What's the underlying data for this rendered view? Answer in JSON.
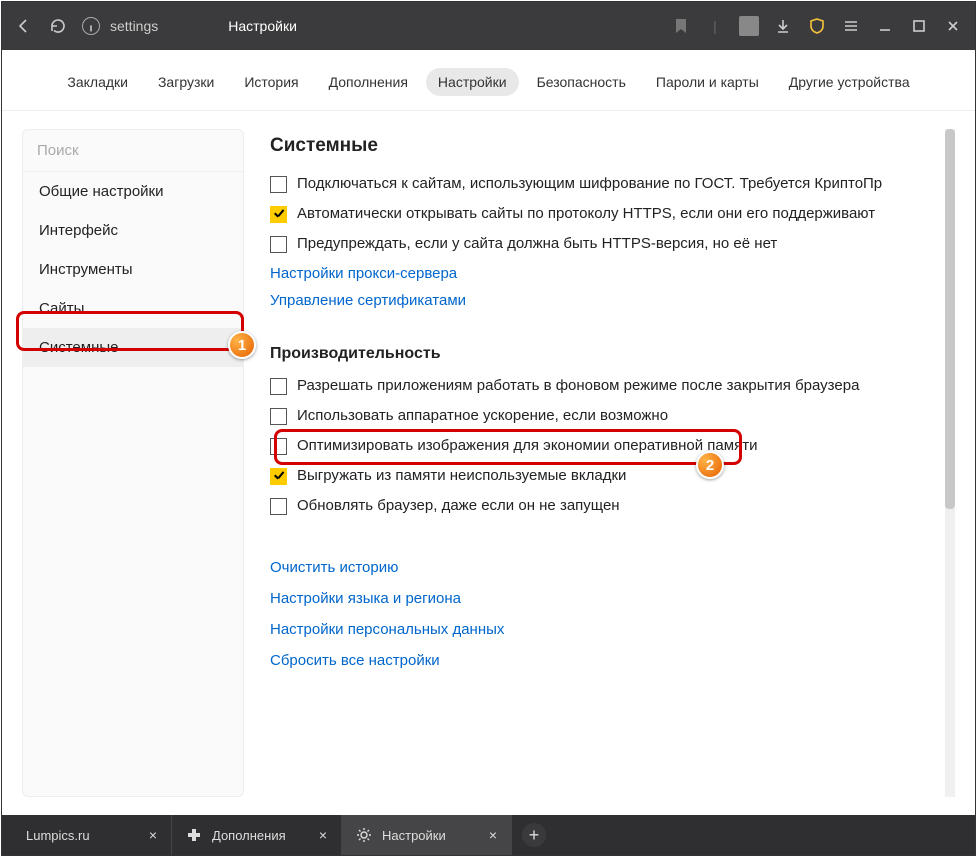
{
  "titlebar": {
    "address_text": "settings",
    "page_title": "Настройки"
  },
  "top_tabs": [
    "Закладки",
    "Загрузки",
    "История",
    "Дополнения",
    "Настройки",
    "Безопасность",
    "Пароли и карты",
    "Другие устройства"
  ],
  "top_tabs_active_index": 4,
  "sidebar": {
    "search_placeholder": "Поиск",
    "items": [
      "Общие настройки",
      "Интерфейс",
      "Инструменты",
      "Сайты",
      "Системные"
    ],
    "active_index": 4
  },
  "main": {
    "section_title": "Системные",
    "system_options": [
      {
        "label": "Подключаться к сайтам, использующим шифрование по ГОСТ. Требуется КриптоПр",
        "checked": false
      },
      {
        "label": "Автоматически открывать сайты по протоколу HTTPS, если они его поддерживают",
        "checked": true
      },
      {
        "label": "Предупреждать, если у сайта должна быть HTTPS-версия, но её нет",
        "checked": false
      }
    ],
    "system_links": [
      "Настройки прокси-сервера",
      "Управление сертификатами"
    ],
    "perf_title": "Производительность",
    "perf_options": [
      {
        "label": "Разрешать приложениям работать в фоновом режиме после закрытия браузера",
        "checked": false
      },
      {
        "label": "Использовать аппаратное ускорение, если возможно",
        "checked": false
      },
      {
        "label": "Оптимизировать изображения для экономии оперативной памяти",
        "checked": false
      },
      {
        "label": "Выгружать из памяти неиспользуемые вкладки",
        "checked": true
      },
      {
        "label": "Обновлять браузер, даже если он не запущен",
        "checked": false
      }
    ],
    "bottom_links": [
      "Очистить историю",
      "Настройки языка и региона",
      "Настройки персональных данных",
      "Сбросить все настройки"
    ]
  },
  "bottom_tabs": [
    {
      "label": "Lumpics.ru",
      "icon_color": "#ff7a00"
    },
    {
      "label": "Дополнения",
      "icon_color": "#fff"
    },
    {
      "label": "Настройки",
      "icon_color": "#fff"
    }
  ],
  "bottom_active_index": 2,
  "callouts": {
    "badge1": "1",
    "badge2": "2"
  }
}
